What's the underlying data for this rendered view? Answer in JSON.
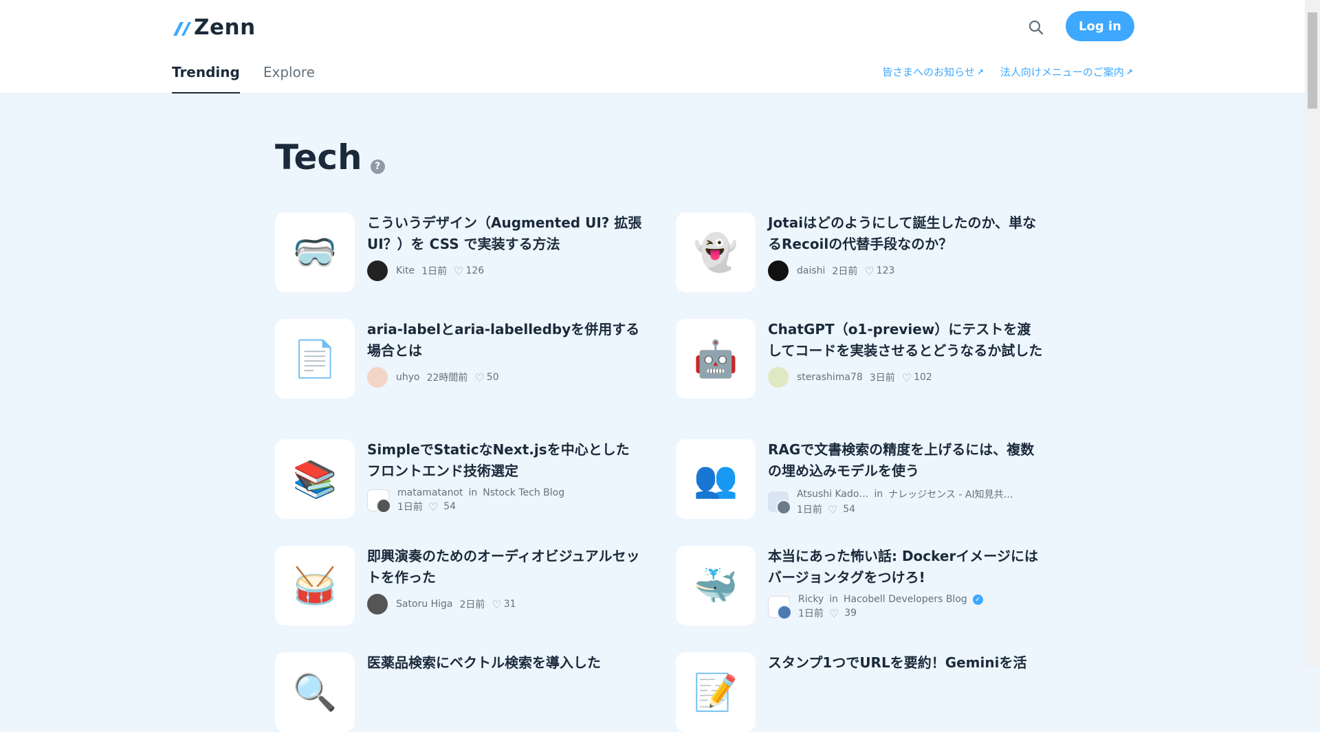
{
  "brand": {
    "name": "Zenn"
  },
  "header": {
    "login_label": "Log in",
    "tabs": [
      {
        "label": "Trending",
        "active": true
      },
      {
        "label": "Explore",
        "active": false
      }
    ],
    "links": [
      {
        "label": "皆さまへのお知らせ"
      },
      {
        "label": "法人向けメニューのご案内"
      }
    ]
  },
  "section": {
    "title": "Tech",
    "help_glyph": "?"
  },
  "articles": [
    {
      "emoji": "🥽",
      "title": "こういうデザイン（Augmented UI? 拡張 UI？）を CSS で実装する方法",
      "author": "Kite",
      "time": "1日前",
      "likes": "126",
      "avatar_color": "#222222"
    },
    {
      "emoji": "👻",
      "title": "Jotaiはどのようにして誕生したのか、単なるRecoilの代替手段なのか？",
      "author": "daishi",
      "time": "2日前",
      "likes": "123",
      "avatar_color": "#111111"
    },
    {
      "emoji": "📄",
      "title": "aria-labelとaria-labelledbyを併用する場合とは",
      "author": "uhyo",
      "time": "22時間前",
      "likes": "50",
      "avatar_color": "#f3d5c8"
    },
    {
      "emoji": "🤖",
      "title": "ChatGPT（o1-preview）にテストを渡してコードを実装させるとどうなるか試した",
      "author": "sterashima78",
      "time": "3日前",
      "likes": "102",
      "avatar_color": "#dfe8c2"
    },
    {
      "emoji": "📚",
      "title": "SimpleでStaticなNext.jsを中心としたフロントエンド技術選定",
      "author": "matamatanot",
      "in_label": "in",
      "publication": "Nstock Tech Blog",
      "time": "1日前",
      "likes": "54",
      "avatar_color": "#ffffff"
    },
    {
      "emoji": "👥",
      "title": "RAGで文書検索の精度を上げるには、複数の埋め込みモデルを使う",
      "author": "Atsushi Kado…",
      "in_label": "in",
      "publication": "ナレッジセンス - AI知見共…",
      "time": "1日前",
      "likes": "54",
      "avatar_color": "#d9e6f2"
    },
    {
      "emoji": "🥁",
      "title": "即興演奏のためのオーディオビジュアルセットを作った",
      "author": "Satoru Higa",
      "time": "2日前",
      "likes": "31",
      "avatar_color": "#555555"
    },
    {
      "emoji": "🐳",
      "title": "本当にあった怖い話: Dockerイメージにはバージョンタグをつけろ!",
      "author": "Ricky",
      "in_label": "in",
      "publication": "Hacobell Developers Blog",
      "verified": "✓",
      "time": "1日前",
      "likes": "39",
      "avatar_color": "#ffffff"
    },
    {
      "emoji": "🔍",
      "title": "医薬品検索にベクトル検索を導入した",
      "author": "",
      "time": "",
      "likes": "",
      "avatar_color": "#cccccc"
    },
    {
      "emoji": "📝",
      "title": "スタンプ1つでURLを要約！Geminiを活",
      "author": "",
      "time": "",
      "likes": "",
      "avatar_color": "#cccccc"
    }
  ]
}
